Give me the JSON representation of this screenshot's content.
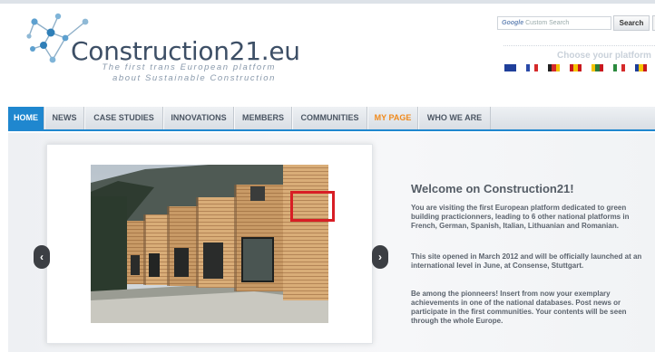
{
  "header": {
    "logo_main": "Construction21",
    "logo_suffix": ".eu",
    "tagline_line1": "The first trans European platform",
    "tagline_line2": "about Sustainable Construction",
    "search_google": "Google",
    "search_placeholder": "Custom Search",
    "search_button": "Search",
    "choose_platform": "Choose your platform",
    "flags": [
      {
        "name": "eu-flag-icon",
        "colors": [
          "#1f3f9a",
          "#1f3f9a",
          "#1f3f9a"
        ]
      },
      {
        "name": "france-flag-icon",
        "colors": [
          "#2a4aa8",
          "#ffffff",
          "#d52a2a"
        ]
      },
      {
        "name": "germany-flag-icon",
        "colors": [
          "#222222",
          "#d52a2a",
          "#f2c200"
        ]
      },
      {
        "name": "spain-flag-icon",
        "colors": [
          "#c8181e",
          "#f5c400",
          "#c8181e"
        ]
      },
      {
        "name": "lithuania-flag-icon",
        "colors": [
          "#f5c400",
          "#2b7d3c",
          "#c8181e"
        ]
      },
      {
        "name": "italy-flag-icon",
        "colors": [
          "#2b8a3e",
          "#ffffff",
          "#d52a2a"
        ]
      },
      {
        "name": "romania-flag-icon",
        "colors": [
          "#1f3f9a",
          "#f5c400",
          "#c8181e"
        ]
      }
    ]
  },
  "nav": {
    "items": [
      {
        "label": "HOME",
        "active": true
      },
      {
        "label": "NEWS"
      },
      {
        "label": "CASE STUDIES"
      },
      {
        "label": "INNOVATIONS"
      },
      {
        "label": "MEMBERS"
      },
      {
        "label": "COMMUNITIES"
      },
      {
        "label": "MY PAGE",
        "highlight": true
      },
      {
        "label": "WHO WE ARE"
      }
    ]
  },
  "slider": {
    "prev": "‹",
    "next": "›"
  },
  "welcome": {
    "title": "Welcome on Construction21!",
    "p1": "You are visiting the first European platform dedicated to green building practicionners, leading to 6 other national platforms in French, German, Spanish, Italian, Lithuanian and Romanian.",
    "p2": "This site opened in March 2012 and will be officially launched at an international level in June, at Consense, Stuttgart.",
    "p3": "Be among the pionneers! Insert from now your exemplary achievements in one of the national databases. Post news or participate in the first communities. Your contents will be seen through the whole Europe."
  },
  "colors": {
    "nav_active": "#1f87cf",
    "my_page": "#f08a1c",
    "highlight": "#d81e25"
  }
}
